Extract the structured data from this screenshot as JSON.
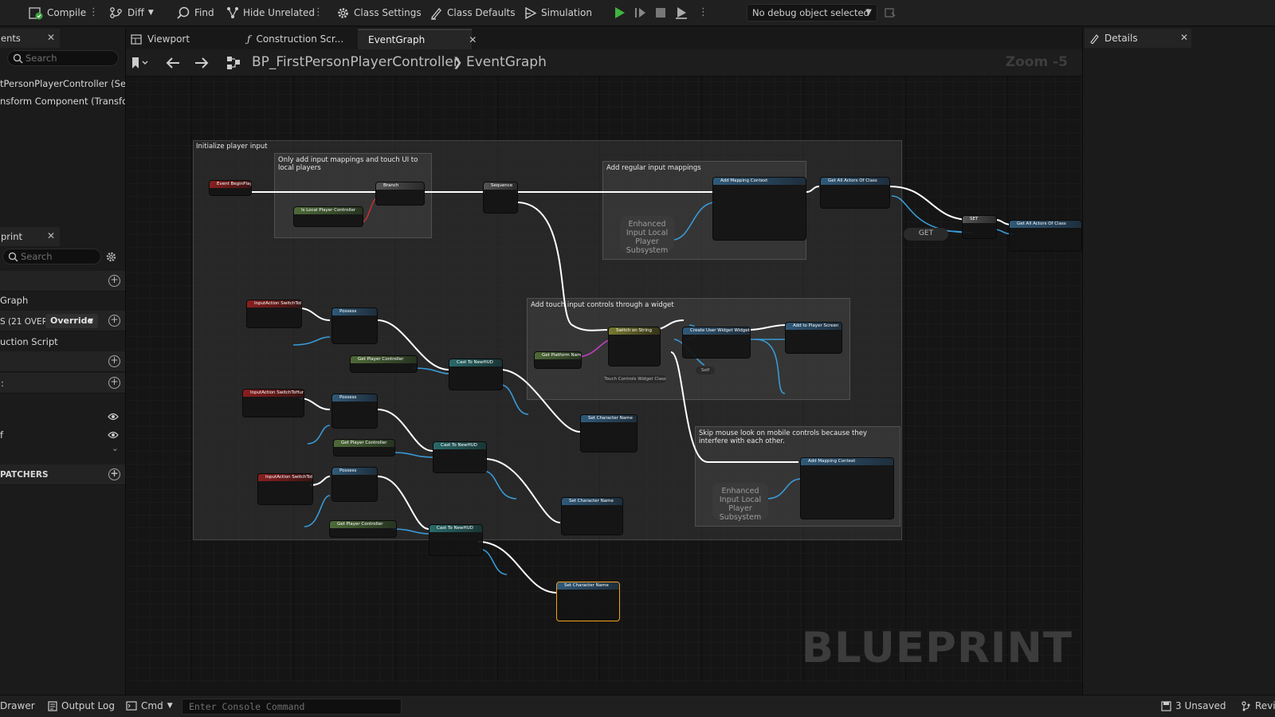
{
  "toolbar": {
    "compile": "Compile",
    "diff": "Diff",
    "find": "Find",
    "hide_unrelated": "Hide Unrelated",
    "class_settings": "Class Settings",
    "class_defaults": "Class Defaults",
    "simulation": "Simulation",
    "debug_object": "No debug object selected"
  },
  "left_panel": {
    "components_tab": "ents",
    "search_placeholder": "Search",
    "components": [
      "tPersonPlayerController (Se",
      "nsform Component (Transfor"
    ],
    "blueprint_tab": "print",
    "mybp_search_placeholder": "Search",
    "graphs_label": "Graph",
    "functions_label": "S (21 OVERR",
    "override_label": "Override",
    "construction_script": "uction Script",
    "macros_label": "",
    "variables_label": "",
    "var1": "",
    "var2": "f",
    "dispatchers_label": "PATCHERS"
  },
  "tabs": [
    {
      "label": "Viewport"
    },
    {
      "label": "Construction Scr..."
    },
    {
      "label": "EventGraph"
    }
  ],
  "breadcrumb": {
    "blueprint": "BP_FirstPersonPlayerController",
    "graph": "EventGraph",
    "zoom": "Zoom -5"
  },
  "graph": {
    "comment_main": "Initialize player input",
    "comment_local": "Only add input mappings and touch UI to local players",
    "comment_regular": "Add regular input mappings",
    "comment_touch": "Add touch input controls through a widget",
    "comment_mouse": "Skip mouse look on mobile controls because they interfere with each other.",
    "subsystem_1": "Enhanced Input Local Player Subsystem",
    "subsystem_2": "Enhanced Input Local Player Subsystem",
    "get_label": "GET",
    "nodes": {
      "begin_play": "Event BeginPlay",
      "branch": "Branch",
      "local_pc": "Is Local Player Controller",
      "sequence": "Sequence",
      "add_mapping_1": "Add Mapping Context",
      "get_all_actors_1": "Get All Actors Of Class",
      "set_node": "SET",
      "get_all_actors_2": "Get All Actors Of Class",
      "input_switch_tolled": "InputAction SwitchToBird",
      "possess_1": "Possess",
      "get_pc_1": "Get Player Controller",
      "cast_1": "Cast To NewHUD",
      "input_switch_human": "InputAction SwitchToHuman",
      "possess_2": "Possess",
      "get_pc_2": "Get Player Controller",
      "cast_2": "Cast To NewHUD",
      "input_switch_other": "InputAction SwitchToBike",
      "possess_3": "Possess",
      "get_pc_3": "Get Player Controller",
      "cast_3": "Cast To NewHUD",
      "set_char_name_1": "Set Character Name",
      "set_char_name_2": "Set Character Name",
      "set_char_name_3": "Set Character Name",
      "switch_string": "Switch on String",
      "get_platform": "Get Platform Name",
      "create_widget": "Create User Widget Widget",
      "add_viewport": "Add to Player Screen",
      "add_mapping_2": "Add Mapping Context",
      "touch_class": "Touch Controls Widget Class",
      "self_label": "Self"
    }
  },
  "watermark": "BLUEPRINT",
  "right_panel": {
    "details_tab": "Details"
  },
  "bottom": {
    "drawer": "Drawer",
    "output_log": "Output Log",
    "cmd": "Cmd",
    "console_placeholder": "Enter Console Command",
    "unsaved": "3 Unsaved",
    "revision": "Revi"
  }
}
